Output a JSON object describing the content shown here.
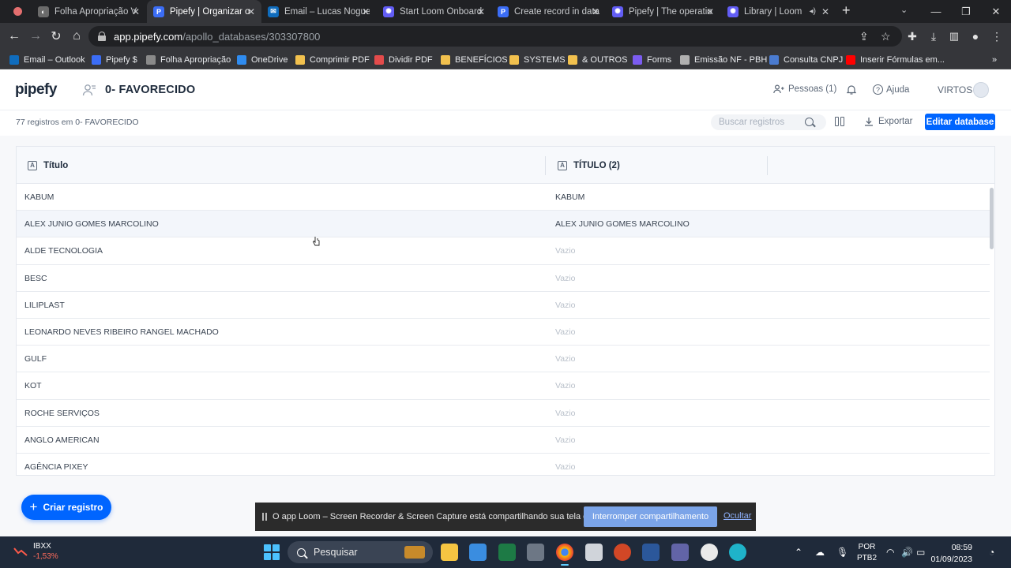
{
  "browser": {
    "tabs": [
      {
        "title": "Folha Apropriação V",
        "icon_color": "#6b6b6b",
        "icon_glyph": "◐"
      },
      {
        "title": "Pipefy | Organizar o",
        "icon_color": "#3b6df6",
        "icon_glyph": "P"
      },
      {
        "title": "Email – Lucas Nogue",
        "icon_color": "#0f6cbd",
        "icon_glyph": "✉"
      },
      {
        "title": "Start Loom Onboard",
        "icon_color": "#625df5",
        "icon_glyph": "✺"
      },
      {
        "title": "Create record in data",
        "icon_color": "#3b6df6",
        "icon_glyph": "P"
      },
      {
        "title": "Pipefy | The operatio",
        "icon_color": "#625df5",
        "icon_glyph": "✺"
      },
      {
        "title": "Library | Loom",
        "icon_color": "#625df5",
        "icon_glyph": "✺"
      }
    ],
    "active_tab_index": 1,
    "url_host": "app.pipefy.com",
    "url_path": "/apollo_databases/303307800",
    "bookmarks": [
      {
        "label": "Email – Outlook",
        "color": "#0f6cbd"
      },
      {
        "label": "Pipefy $",
        "color": "#3b6df6"
      },
      {
        "label": "Folha Apropriação",
        "color": "#8a8a8a"
      },
      {
        "label": "OneDrive",
        "color": "#2f8cf0"
      },
      {
        "label": "Comprimir PDF",
        "color": "#f2c14e"
      },
      {
        "label": "Dividir PDF",
        "color": "#e34b4b"
      },
      {
        "label": "BENEFÍCIOS",
        "color": "#f2c14e"
      },
      {
        "label": "SYSTEMS",
        "color": "#f2c14e"
      },
      {
        "label": "& OUTROS",
        "color": "#f2c14e"
      },
      {
        "label": "Forms",
        "color": "#7b5cf0"
      },
      {
        "label": "Emissão NF - PBH",
        "color": "#b0b0b0"
      },
      {
        "label": "Consulta CNPJ",
        "color": "#4a7bd0"
      },
      {
        "label": "Inserir Fórmulas em...",
        "color": "#ff0000"
      }
    ],
    "bookmarks_more": "»"
  },
  "header": {
    "logo": "pipefy",
    "db_title": "0- FAVORECIDO",
    "people_label": "Pessoas (1)",
    "help_label": "Ajuda",
    "org_name": "VIRTOS"
  },
  "toolbar": {
    "record_count": "77 registros em 0- FAVORECIDO",
    "search_placeholder": "Buscar registros",
    "export_label": "Exportar",
    "edit_db_label": "Editar database"
  },
  "table": {
    "columns": [
      "Título",
      "TÍTULO (2)"
    ],
    "rows": [
      [
        "KABUM",
        "KABUM"
      ],
      [
        "ALEX JUNIO GOMES MARCOLINO",
        "ALEX JUNIO GOMES MARCOLINO"
      ],
      [
        "ALDE TECNOLOGIA",
        "Vazio"
      ],
      [
        "BESC",
        "Vazio"
      ],
      [
        "LILIPLAST",
        "Vazio"
      ],
      [
        "LEONARDO NEVES RIBEIRO RANGEL MACHADO",
        "Vazio"
      ],
      [
        "GULF",
        "Vazio"
      ],
      [
        "KOT",
        "Vazio"
      ],
      [
        "ROCHE SERVIÇOS",
        "Vazio"
      ],
      [
        "ANGLO AMERICAN",
        "Vazio"
      ],
      [
        "AGÊNCIA PIXEY",
        "Vazio"
      ]
    ],
    "empty_value": "Vazio",
    "hover_row_index": 1
  },
  "create_button_label": "Criar registro",
  "loom_bar": {
    "message": "O app Loom – Screen Recorder & Screen Capture está compartilhando sua tela e áudio.",
    "stop_label": "Interromper compartilhamento",
    "hide_label": "Ocultar"
  },
  "taskbar": {
    "ticker_name": "IBXX",
    "ticker_change": "-1,53%",
    "search_label": "Pesquisar",
    "lang_line1": "POR",
    "lang_line2": "PTB2",
    "time": "08:59",
    "date": "01/09/2023"
  }
}
